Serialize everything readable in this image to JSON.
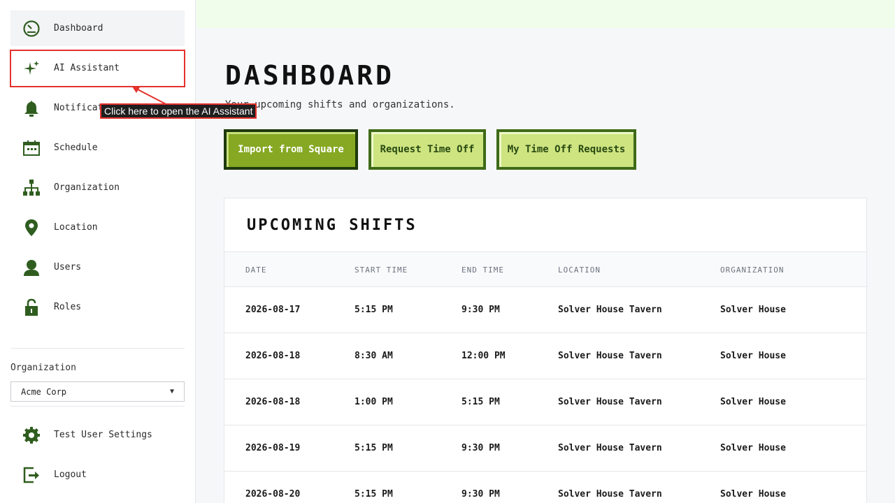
{
  "sidebar": {
    "items": [
      {
        "label": "Dashboard",
        "icon": "dashboard-icon"
      },
      {
        "label": "AI Assistant",
        "icon": "sparkle-icon"
      },
      {
        "label": "Notifications",
        "icon": "bell-icon"
      },
      {
        "label": "Schedule",
        "icon": "calendar-icon"
      },
      {
        "label": "Organization",
        "icon": "org-chart-icon"
      },
      {
        "label": "Location",
        "icon": "map-pin-icon"
      },
      {
        "label": "Users",
        "icon": "user-icon"
      },
      {
        "label": "Roles",
        "icon": "lock-icon"
      }
    ],
    "organization_label": "Organization",
    "organization_selected": "Acme Corp",
    "footer": [
      {
        "label": "Test User Settings",
        "icon": "gear-icon"
      },
      {
        "label": "Logout",
        "icon": "logout-icon"
      }
    ]
  },
  "tooltip": {
    "text": "Click here to open the AI Assistant"
  },
  "header": {
    "title": "DASHBOARD",
    "subtitle": "Your upcoming shifts and organizations."
  },
  "actions": {
    "import": "Import from Square",
    "request_time_off": "Request Time Off",
    "my_time_off": "My Time Off Requests"
  },
  "shifts": {
    "title": "UPCOMING SHIFTS",
    "columns": [
      "DATE",
      "START TIME",
      "END TIME",
      "LOCATION",
      "ORGANIZATION"
    ],
    "rows": [
      [
        "2026-08-17",
        "5:15 PM",
        "9:30 PM",
        "Solver House Tavern",
        "Solver House"
      ],
      [
        "2026-08-18",
        "8:30 AM",
        "12:00 PM",
        "Solver House Tavern",
        "Solver House"
      ],
      [
        "2026-08-18",
        "1:00 PM",
        "5:15 PM",
        "Solver House Tavern",
        "Solver House"
      ],
      [
        "2026-08-19",
        "5:15 PM",
        "9:30 PM",
        "Solver House Tavern",
        "Solver House"
      ],
      [
        "2026-08-20",
        "5:15 PM",
        "9:30 PM",
        "Solver House Tavern",
        "Solver House"
      ]
    ]
  },
  "colors": {
    "accent": "#86a822",
    "icon": "#2f5d1f",
    "highlight": "#e5312c"
  }
}
